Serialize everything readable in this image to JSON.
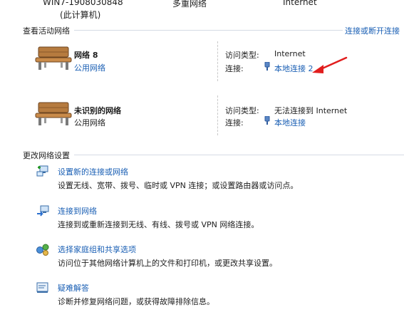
{
  "top_row": {
    "computer_name": "WIN7-1908030848",
    "computer_sub": "(此计算机)",
    "middle_label": "多重网络",
    "right_label": "Internet"
  },
  "active_networks": {
    "heading": "查看活动网络",
    "connect_link": "连接或断开连接",
    "networks": [
      {
        "name": "网络  8",
        "type_label": "公用网络",
        "access_type_label": "访问类型:",
        "access_type_value": "Internet",
        "connection_label": "连接:",
        "connection_value": "本地连接 2"
      },
      {
        "name": "未识别的网络",
        "type_label": "公用网络",
        "access_type_label": "访问类型:",
        "access_type_value": "无法连接到 Internet",
        "connection_label": "连接:",
        "connection_value": "本地连接"
      }
    ]
  },
  "change_settings": {
    "heading": "更改网络设置",
    "items": [
      {
        "title": "设置新的连接或网络",
        "desc": "设置无线、宽带、拨号、临时或 VPN 连接；或设置路由器或访问点。",
        "icon": "new-connection-icon"
      },
      {
        "title": "连接到网络",
        "desc": "连接到或重新连接到无线、有线、拨号或 VPN 网络连接。",
        "icon": "connect-network-icon"
      },
      {
        "title": "选择家庭组和共享选项",
        "desc": "访问位于其他网络计算机上的文件和打印机，或更改共享设置。",
        "icon": "homegroup-icon"
      },
      {
        "title": "疑难解答",
        "desc": "诊断并修复网络问题，或获得故障排除信息。",
        "icon": "troubleshoot-icon"
      }
    ]
  },
  "colors": {
    "link": "#1a5fb4",
    "arrow": "#e11d1d",
    "separator": "#d5dbe5"
  }
}
